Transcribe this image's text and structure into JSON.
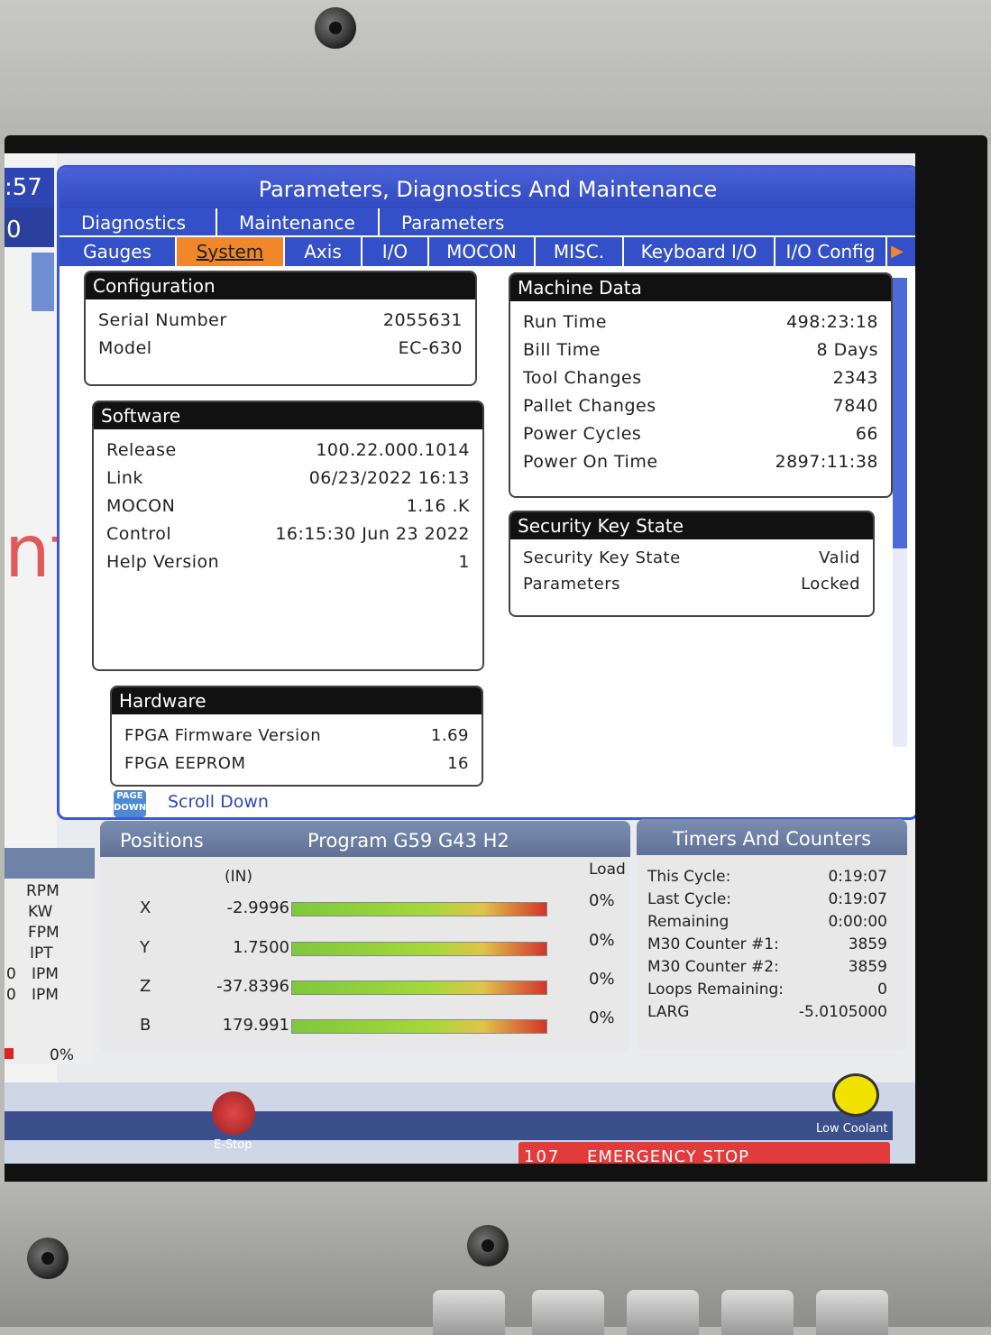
{
  "left_panel": {
    "time": ":57",
    "zero": "0",
    "big_text": "nt"
  },
  "window": {
    "title": "Parameters, Diagnostics And Maintenance",
    "top_tabs": [
      "Diagnostics",
      "Maintenance",
      "Parameters"
    ],
    "sub_tabs": [
      "Gauges",
      "System",
      "Axis",
      "I/O",
      "MOCON",
      "MISC.",
      "Keyboard I/O",
      "I/O Config"
    ],
    "active_sub_tab": "System"
  },
  "configuration": {
    "header": "Configuration",
    "rows": [
      {
        "label": "Serial Number",
        "value": "2055631"
      },
      {
        "label": "Model",
        "value": "EC-630"
      }
    ]
  },
  "software": {
    "header": "Software",
    "rows": [
      {
        "label": "Release",
        "value": "100.22.000.1014"
      },
      {
        "label": "Link",
        "value": "06/23/2022 16:13"
      },
      {
        "label": "MOCON",
        "value": "1.16   .K"
      },
      {
        "label": "Control",
        "value": "16:15:30  Jun 23 2022"
      },
      {
        "label": "Help Version",
        "value": "1"
      }
    ]
  },
  "hardware": {
    "header": "Hardware",
    "rows": [
      {
        "label": "FPGA Firmware Version",
        "value": "1.69"
      },
      {
        "label": "FPGA EEPROM",
        "value": "16"
      }
    ]
  },
  "machine_data": {
    "header": "Machine Data",
    "rows": [
      {
        "label": "Run Time",
        "value": "498:23:18"
      },
      {
        "label": "Bill Time",
        "value": "8 Days"
      },
      {
        "label": "Tool Changes",
        "value": "2343"
      },
      {
        "label": "Pallet Changes",
        "value": "7840"
      },
      {
        "label": "Power Cycles",
        "value": "66"
      },
      {
        "label": "Power On Time",
        "value": "2897:11:38"
      }
    ]
  },
  "security": {
    "header": "Security Key State",
    "rows": [
      {
        "label": "Security Key State",
        "value": "Valid"
      },
      {
        "label": "Parameters",
        "value": "Locked"
      }
    ]
  },
  "page_down": {
    "icon_text": "PAGE DOWN",
    "label": "Scroll Down"
  },
  "spindle": {
    "units": [
      "RPM",
      "KW",
      "FPM",
      "IPT",
      "IPM",
      "IPM"
    ],
    "prefix": [
      "0",
      "0"
    ],
    "load": "0%"
  },
  "positions": {
    "title": "Positions",
    "program": "Program G59 G43 H2",
    "unit": "(IN)",
    "load_label": "Load",
    "axes": [
      {
        "axis": "X",
        "value": "-2.9996",
        "load": "0%"
      },
      {
        "axis": "Y",
        "value": "1.7500",
        "load": "0%"
      },
      {
        "axis": "Z",
        "value": "-37.8396",
        "load": "0%"
      },
      {
        "axis": "B",
        "value": "179.991",
        "load": "0%"
      }
    ]
  },
  "timers": {
    "title": "Timers And Counters",
    "rows": [
      {
        "label": "This Cycle:",
        "value": "0:19:07"
      },
      {
        "label": "Last Cycle:",
        "value": "0:19:07"
      },
      {
        "label": "Remaining",
        "value": "0:00:00"
      },
      {
        "label": "M30 Counter #1:",
        "value": "3859"
      },
      {
        "label": "M30 Counter #2:",
        "value": "3859"
      },
      {
        "label": "Loops Remaining:",
        "value": "0"
      },
      {
        "label": "LARG",
        "value": "-5.0105000"
      }
    ]
  },
  "status": {
    "estop_label": "E-Stop",
    "coolant_label": "Low Coolant",
    "alarm_code": "107",
    "alarm_text": "EMERGENCY STOP"
  },
  "colors": {
    "accent": "#3450c8",
    "active_tab": "#f0872b",
    "alarm": "#e23b3b"
  }
}
